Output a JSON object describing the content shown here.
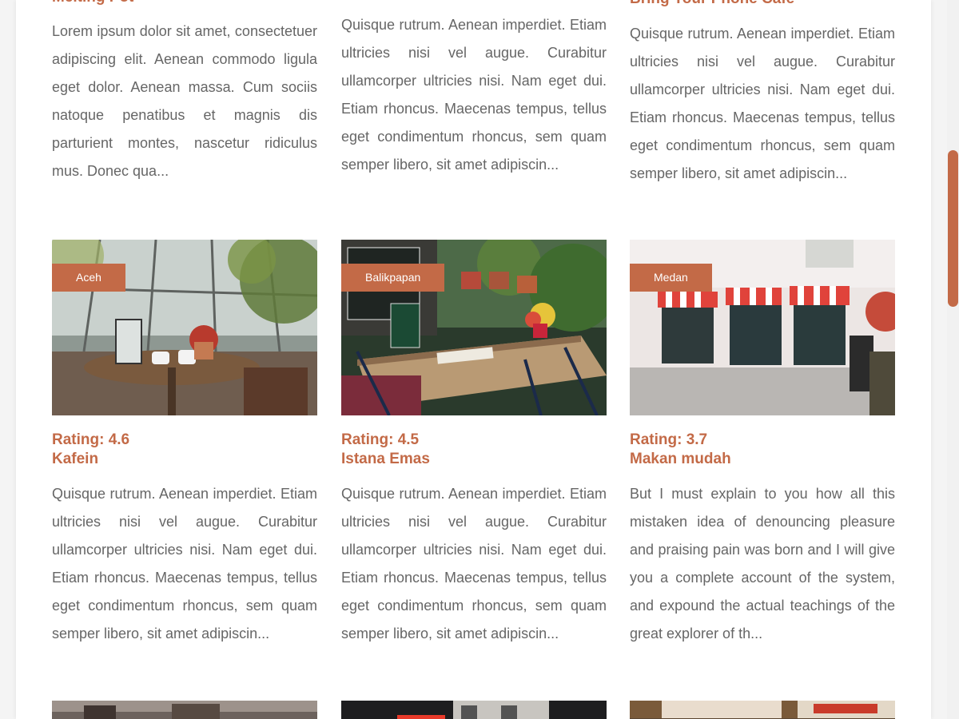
{
  "row1": [
    {
      "title_partial": "Melting Pot",
      "description": "Lorem ipsum dolor sit amet, consectetuer adipiscing elit. Aenean commodo ligula eget dolor. Aenean massa. Cum sociis natoque penatibus et magnis dis parturient montes, nascetur ridiculus mus. Donec qua..."
    },
    {
      "title_partial": "",
      "description": "Quisque rutrum. Aenean imperdiet. Etiam ultricies nisi vel augue. Curabitur ullamcorper ultricies nisi. Nam eget dui. Etiam rhoncus. Maecenas tempus, tellus eget condimentum rhoncus, sem quam semper libero, sit amet adipiscin..."
    },
    {
      "title_partial": "Bring Your Phone Cafe",
      "description": "Quisque rutrum. Aenean imperdiet. Etiam ultricies nisi vel augue. Curabitur ullamcorper ultricies nisi. Nam eget dui. Etiam rhoncus. Maecenas tempus, tellus eget condimentum rhoncus, sem quam semper libero, sit amet adipiscin..."
    }
  ],
  "row2": [
    {
      "city": "Aceh",
      "rating": "Rating: 4.6",
      "name": "Kafein",
      "description": "Quisque rutrum. Aenean imperdiet. Etiam ultricies nisi vel augue. Curabitur ullamcorper ultricies nisi. Nam eget dui. Etiam rhoncus. Maecenas tempus, tellus eget condimentum rhoncus, sem quam semper libero, sit amet adipiscin..."
    },
    {
      "city": "Balikpapan",
      "rating": "Rating: 4.5",
      "name": "Istana Emas",
      "description": "Quisque rutrum. Aenean imperdiet. Etiam ultricies nisi vel augue. Curabitur ullamcorper ultricies nisi. Nam eget dui. Etiam rhoncus. Maecenas tempus, tellus eget condimentum rhoncus, sem quam semper libero, sit amet adipiscin..."
    },
    {
      "city": "Medan",
      "rating": "Rating: 3.7",
      "name": "Makan mudah",
      "description": "But I must explain to you how all this mistaken idea of denouncing pleasure and praising pain was born and I will give you a complete account of the system, and expound the actual teachings of the great explorer of th..."
    }
  ],
  "colors": {
    "accent": "#c36a47",
    "body_text": "#666666",
    "page_bg": "#ffffff"
  }
}
